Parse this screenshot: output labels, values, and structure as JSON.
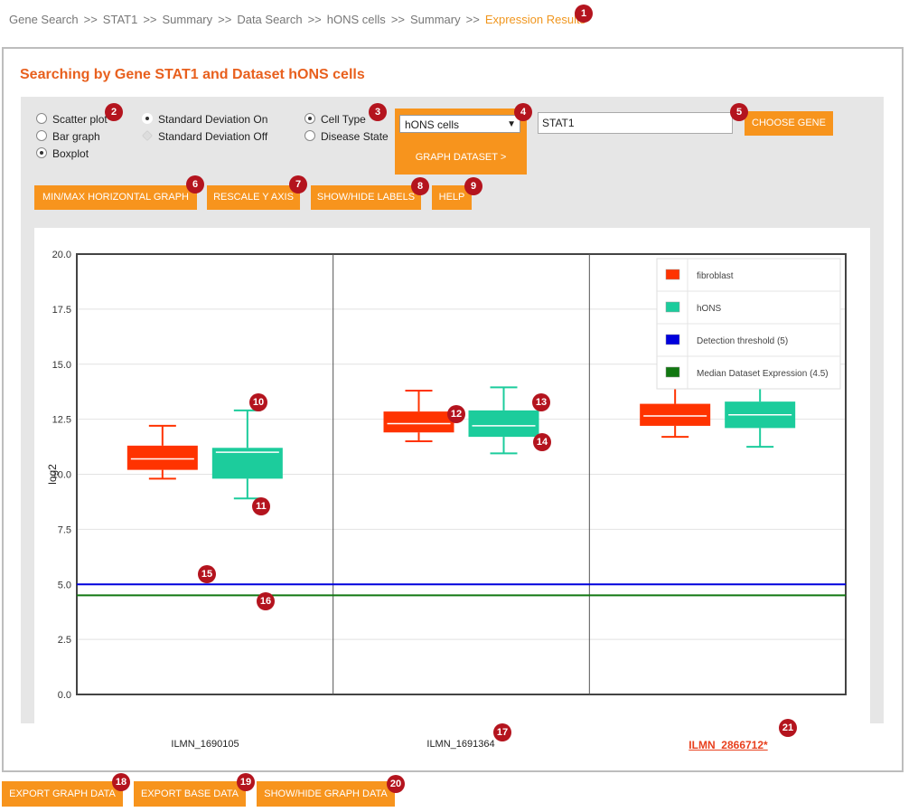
{
  "breadcrumb": {
    "items": [
      "Gene Search",
      "STAT1",
      "Summary",
      "Data Search",
      "hONS cells",
      "Summary"
    ],
    "separator": ">>",
    "current": "Expression Results"
  },
  "title": "Searching by Gene STAT1 and Dataset hONS cells",
  "graph_type": {
    "scatter": "Scatter plot",
    "bar": "Bar graph",
    "boxplot": "Boxplot",
    "selected": "Boxplot"
  },
  "std_dev": {
    "on": "Standard Deviation On",
    "off": "Standard Deviation Off"
  },
  "group_by": {
    "cell_type": "Cell Type",
    "disease_state": "Disease State",
    "selected": "Cell Type"
  },
  "dataset": {
    "selected": "hONS cells",
    "graph_button": "GRAPH DATASET >"
  },
  "gene": {
    "value": "STAT1",
    "choose_button": "CHOOSE GENE"
  },
  "toolbar": {
    "minmax": "MIN/MAX HORIZONTAL GRAPH",
    "rescale": "RESCALE Y AXIS",
    "labels": "SHOW/HIDE LABELS",
    "help": "HELP"
  },
  "bottom_buttons": {
    "export_graph": "EXPORT GRAPH DATA",
    "export_base": "EXPORT BASE DATA",
    "toggle_graph_data": "SHOW/HIDE GRAPH DATA"
  },
  "badges": [
    "1",
    "2",
    "3",
    "4",
    "5",
    "6",
    "7",
    "8",
    "9",
    "10",
    "11",
    "12",
    "13",
    "14",
    "15",
    "16",
    "17",
    "18",
    "19",
    "20",
    "21"
  ],
  "colors": {
    "accent": "#f7941d",
    "title": "#e8601e",
    "fibroblast": "#ff3300",
    "hONS": "#1ccc9c",
    "threshold": "#0000dd",
    "median": "#117711"
  },
  "chart_data": {
    "type": "boxplot",
    "ylabel": "log2",
    "ylim": [
      0,
      20
    ],
    "yticks": [
      "0.0",
      "2.5",
      "5.0",
      "7.5",
      "10.0",
      "12.5",
      "15.0",
      "17.5",
      "20.0"
    ],
    "categories": [
      "ILMN_1690105",
      "ILMN_1691364",
      "ILMN_2866712*"
    ],
    "series": [
      {
        "name": "fibroblast",
        "boxes": [
          {
            "min": 9.8,
            "q1": 10.2,
            "median": 10.7,
            "q3": 11.3,
            "max": 12.2
          },
          {
            "min": 11.5,
            "q1": 11.9,
            "median": 12.3,
            "q3": 12.85,
            "max": 13.8
          },
          {
            "min": 11.7,
            "q1": 12.2,
            "median": 12.65,
            "q3": 13.2,
            "max": 14.1
          }
        ]
      },
      {
        "name": "hONS",
        "boxes": [
          {
            "min": 8.9,
            "q1": 9.8,
            "median": 11.0,
            "q3": 11.2,
            "max": 12.9
          },
          {
            "min": 10.95,
            "q1": 11.7,
            "median": 12.2,
            "q3": 12.9,
            "max": 13.95
          },
          {
            "min": 11.25,
            "q1": 12.1,
            "median": 12.7,
            "q3": 13.3,
            "max": 14.3
          }
        ]
      }
    ],
    "lines": [
      {
        "name": "Detection threshold (5)",
        "value": 5.0
      },
      {
        "name": "Median Dataset Expression (4.5)",
        "value": 4.5
      }
    ],
    "legend": [
      "fibroblast",
      "hONS",
      "Detection threshold (5)",
      "Median Dataset Expression (4.5)"
    ],
    "legend_position": "top-right"
  }
}
